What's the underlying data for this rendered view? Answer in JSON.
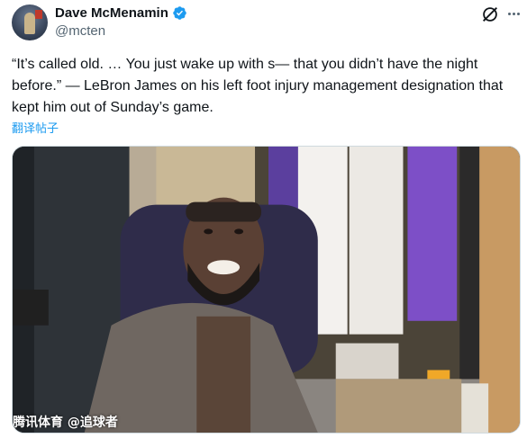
{
  "author": {
    "display_name": "Dave McMenamin",
    "handle": "@mcten",
    "verified": true,
    "avatar_icon": "avatar-image"
  },
  "post": {
    "text": "“It’s called old. … You just wake up with s— that you didn’t have the night before.” — LeBron James on his left foot injury management designation that kept him out of Sunday’s game.",
    "translate_label": "翻译帖子"
  },
  "media": {
    "watermark": "腾讯体育 @追球者"
  },
  "colors": {
    "link": "#1d9bf0",
    "verified": "#1d9bf0",
    "secondary_text": "#536471"
  },
  "icons": {
    "verified": "verified-badge-icon",
    "grok": "grok-icon",
    "more": "more-options-icon"
  }
}
